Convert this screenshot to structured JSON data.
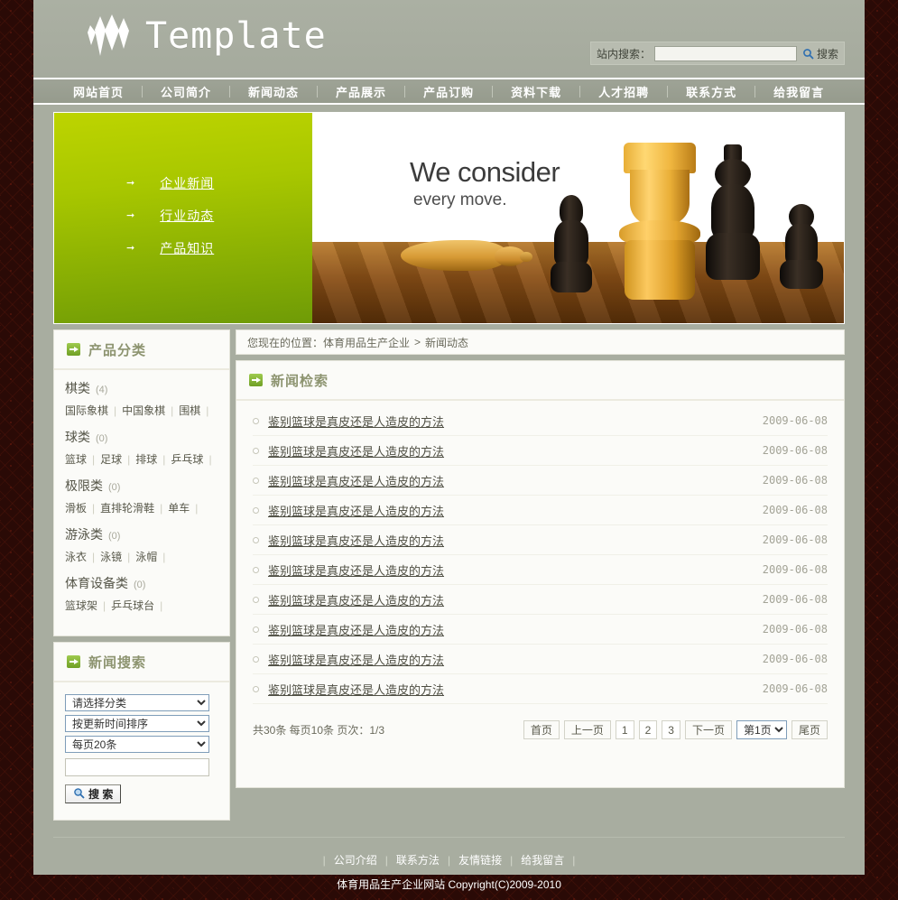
{
  "header": {
    "logo_text": "Template",
    "logo_icon": "diamond-star-logo",
    "search": {
      "label": "站内搜索：",
      "value": "",
      "placeholder": "",
      "button_label": "搜索",
      "icon": "search-icon"
    }
  },
  "nav": {
    "items": [
      {
        "label": "网站首页"
      },
      {
        "label": "公司简介"
      },
      {
        "label": "新闻动态"
      },
      {
        "label": "产品展示"
      },
      {
        "label": "产品订购"
      },
      {
        "label": "资料下载"
      },
      {
        "label": "人才招聘"
      },
      {
        "label": "联系方式"
      },
      {
        "label": "给我留言"
      }
    ]
  },
  "banner": {
    "links": [
      {
        "label": "企业新闻",
        "icon": "arrow-right-icon"
      },
      {
        "label": "行业动态",
        "icon": "arrow-right-icon"
      },
      {
        "label": "产品知识",
        "icon": "arrow-right-icon"
      }
    ],
    "image_caption_line1": "We consider",
    "image_caption_line2": "every move."
  },
  "sidebar": {
    "categories_panel": {
      "title": "产品分类",
      "icon": "arrow-box-icon",
      "groups": [
        {
          "name": "棋类",
          "count": "(4)",
          "subs": [
            "国际象棋",
            "中国象棋",
            "围棋"
          ]
        },
        {
          "name": "球类",
          "count": "(0)",
          "subs": [
            "篮球",
            "足球",
            "排球",
            "乒乓球"
          ]
        },
        {
          "name": "极限类",
          "count": "(0)",
          "subs": [
            "滑板",
            "直排轮滑鞋",
            "单车"
          ]
        },
        {
          "name": "游泳类",
          "count": "(0)",
          "subs": [
            "泳衣",
            "泳镜",
            "泳帽"
          ]
        },
        {
          "name": "体育设备类",
          "count": "(0)",
          "subs": [
            "篮球架",
            "乒乓球台"
          ]
        }
      ]
    },
    "news_search_panel": {
      "title": "新闻搜索",
      "icon": "arrow-box-icon",
      "category_select": "请选择分类",
      "sort_select": "按更新时间排序",
      "perpage_select": "每页20条",
      "keyword_value": "",
      "keyword_placeholder": "",
      "button_label": "搜 索",
      "button_icon": "search-icon"
    }
  },
  "main": {
    "breadcrumb": {
      "prefix": "您现在的位置：",
      "root": "体育用品生产企业",
      "separator": ">",
      "current": "新闻动态"
    },
    "news_panel": {
      "title": "新闻检索",
      "icon": "arrow-box-icon",
      "items": [
        {
          "title": "鉴别篮球是真皮还是人造皮的方法",
          "date": "2009-06-08"
        },
        {
          "title": "鉴别篮球是真皮还是人造皮的方法",
          "date": "2009-06-08"
        },
        {
          "title": "鉴别篮球是真皮还是人造皮的方法",
          "date": "2009-06-08"
        },
        {
          "title": "鉴别篮球是真皮还是人造皮的方法",
          "date": "2009-06-08"
        },
        {
          "title": "鉴别篮球是真皮还是人造皮的方法",
          "date": "2009-06-08"
        },
        {
          "title": "鉴别篮球是真皮还是人造皮的方法",
          "date": "2009-06-08"
        },
        {
          "title": "鉴别篮球是真皮还是人造皮的方法",
          "date": "2009-06-08"
        },
        {
          "title": "鉴别篮球是真皮还是人造皮的方法",
          "date": "2009-06-08"
        },
        {
          "title": "鉴别篮球是真皮还是人造皮的方法",
          "date": "2009-06-08"
        },
        {
          "title": "鉴别篮球是真皮还是人造皮的方法",
          "date": "2009-06-08"
        }
      ]
    },
    "pager": {
      "info": "共30条 每页10条 页次：1/3",
      "first": "首页",
      "prev": "上一页",
      "pages": [
        "1",
        "2",
        "3"
      ],
      "next": "下一页",
      "jump_value": "第1页",
      "last": "尾页"
    }
  },
  "footer": {
    "links": [
      "公司介绍",
      "联系方法",
      "友情链接",
      "给我留言"
    ],
    "copyright": "体育用品生产企业网站  Copyright(C)2009-2010"
  },
  "colors": {
    "shell": "#a8ada0",
    "accent_green": "#8d9470",
    "banner_green": "#a8c700",
    "panel_bg": "#fbfbf8",
    "page_bg": "#2a0a06"
  }
}
